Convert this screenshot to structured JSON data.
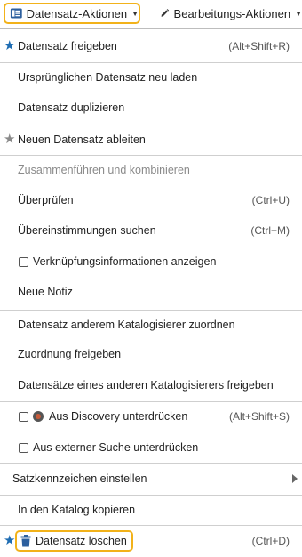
{
  "toolbar": {
    "record_actions_label": "Datensatz-Aktionen",
    "edit_actions_label": "Bearbeitungs-Aktionen",
    "colors": {
      "highlight": "#f2b21a",
      "accent": "#1f6db3"
    }
  },
  "menu": {
    "release_record": {
      "label": "Datensatz freigeben",
      "shortcut": "(Alt+Shift+R)"
    },
    "reload_original": {
      "label": "Ursprünglichen Datensatz neu laden"
    },
    "duplicate": {
      "label": "Datensatz duplizieren"
    },
    "derive_new": {
      "label": "Neuen Datensatz ableiten"
    },
    "merge_combine": {
      "label": "Zusammenführen und kombinieren"
    },
    "validate": {
      "label": "Überprüfen",
      "shortcut": "(Ctrl+U)"
    },
    "find_matches": {
      "label": "Übereinstimmungen suchen",
      "shortcut": "(Ctrl+M)"
    },
    "show_linking_info": {
      "label": "Verknüpfungsinformationen anzeigen",
      "checked": false
    },
    "new_note": {
      "label": "Neue Notiz"
    },
    "assign_cataloger": {
      "label": "Datensatz anderem Katalogisierer zuordnen"
    },
    "release_assignment": {
      "label": "Zuordnung freigeben"
    },
    "release_other_cataloger": {
      "label": "Datensätze eines anderen Katalogisierers freigeben"
    },
    "suppress_discovery": {
      "label": "Aus Discovery unterdrücken",
      "shortcut": "(Alt+Shift+S)",
      "checked": false
    },
    "suppress_external": {
      "label": "Aus externer Suche unterdrücken",
      "checked": false
    },
    "set_indicators": {
      "label": "Satzkennzeichen einstellen"
    },
    "copy_to_catalog": {
      "label": "In den Katalog kopieren"
    },
    "delete_record": {
      "label": "Datensatz löschen",
      "shortcut": "(Ctrl+D)"
    }
  }
}
